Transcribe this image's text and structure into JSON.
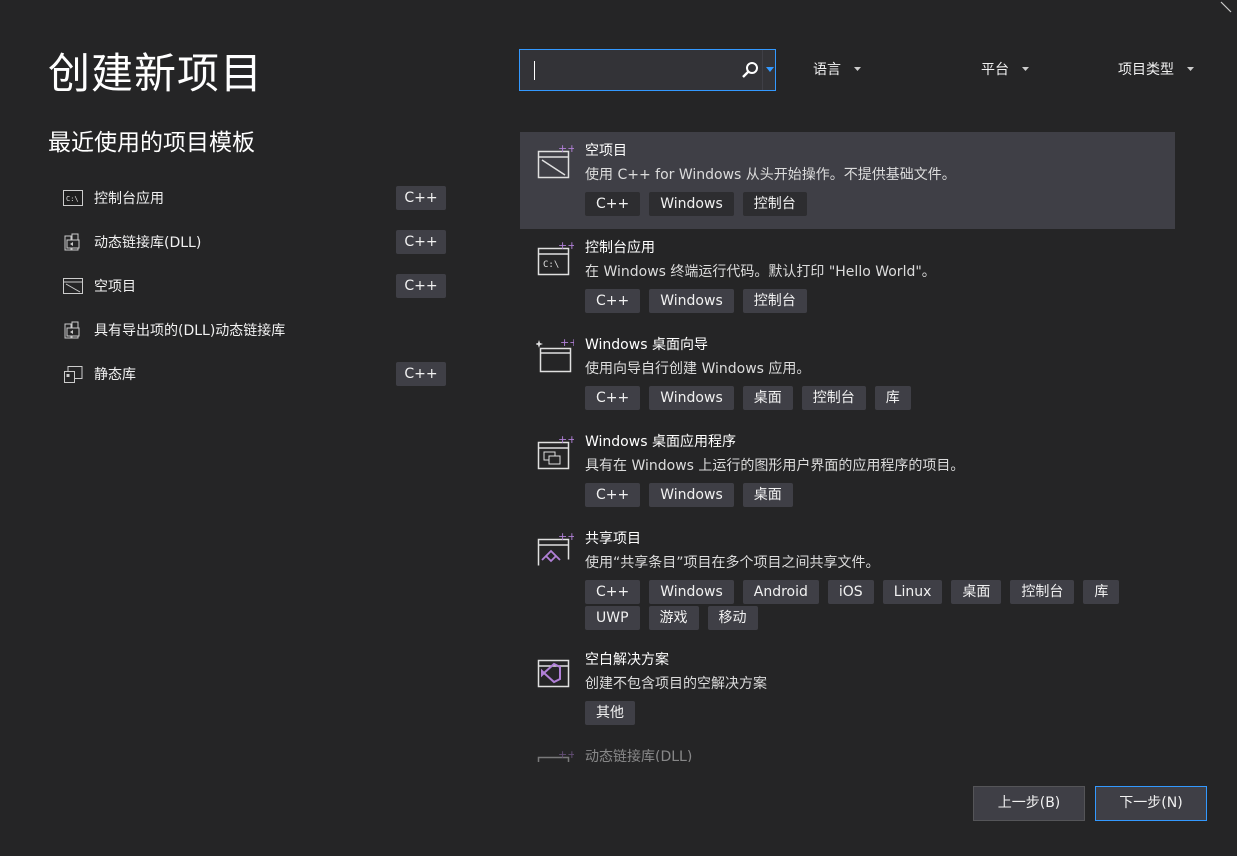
{
  "page": {
    "title": "创建新项目",
    "recent_title": "最近使用的项目模板"
  },
  "recent": [
    {
      "label": "控制台应用",
      "lang": "C++",
      "icon": "console-app-icon"
    },
    {
      "label": "动态链接库(DLL)",
      "lang": "C++",
      "icon": "dll-icon"
    },
    {
      "label": "空项目",
      "lang": "C++",
      "icon": "empty-project-icon"
    },
    {
      "label": "具有导出项的(DLL)动态链接库",
      "lang": "",
      "icon": "dll-export-icon"
    },
    {
      "label": "静态库",
      "lang": "C++",
      "icon": "static-lib-icon"
    }
  ],
  "search": {
    "value": "",
    "placeholder": ""
  },
  "filters": {
    "language": "语言",
    "platform": "平台",
    "project_type": "项目类型"
  },
  "templates": [
    {
      "name": "空项目",
      "desc": "使用 C++ for Windows 从头开始操作。不提供基础文件。",
      "tags": [
        "C++",
        "Windows",
        "控制台"
      ]
    },
    {
      "name": "控制台应用",
      "desc": "在 Windows 终端运行代码。默认打印 \"Hello World\"。",
      "tags": [
        "C++",
        "Windows",
        "控制台"
      ]
    },
    {
      "name": "Windows 桌面向导",
      "desc": "使用向导自行创建 Windows 应用。",
      "tags": [
        "C++",
        "Windows",
        "桌面",
        "控制台",
        "库"
      ]
    },
    {
      "name": "Windows 桌面应用程序",
      "desc": "具有在 Windows 上运行的图形用户界面的应用程序的项目。",
      "tags": [
        "C++",
        "Windows",
        "桌面"
      ]
    },
    {
      "name": "共享项目",
      "desc": "使用“共享条目”项目在多个项目之间共享文件。",
      "tags": [
        "C++",
        "Windows",
        "Android",
        "iOS",
        "Linux",
        "桌面",
        "控制台",
        "库",
        "UWP",
        "游戏",
        "移动"
      ]
    },
    {
      "name": "空白解决方案",
      "desc": "创建不包含项目的空解决方案",
      "tags": [
        "其他"
      ]
    },
    {
      "name": "动态链接库(DLL)",
      "desc": "",
      "tags": []
    }
  ],
  "buttons": {
    "back": "上一步(B)",
    "next": "下一步(N)"
  },
  "colors": {
    "background": "#252526",
    "accent": "#3399ff",
    "selected": "#3f3f46",
    "icon_purple": "#b180d7"
  }
}
